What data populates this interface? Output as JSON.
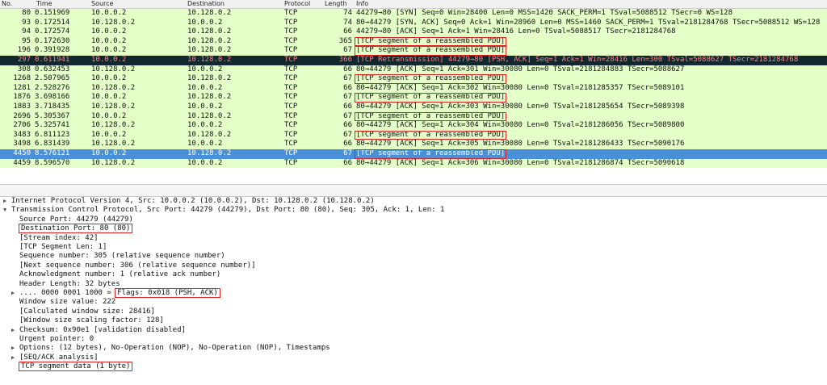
{
  "columns": {
    "no": "No.",
    "time": "Time",
    "source": "Source",
    "destination": "Destination",
    "protocol": "Protocol",
    "length": "Length",
    "info": "Info"
  },
  "packets": [
    {
      "no": "80",
      "time": "0.151969",
      "src": "10.0.0.2",
      "dst": "10.128.0.2",
      "proto": "TCP",
      "len": "74",
      "info": "44279→80 [SYN] Seq=0 Win=28400 Len=0 MSS=1420 SACK_PERM=1 TSval=5088512 TSecr=0 WS=128",
      "style": "green",
      "hl": ""
    },
    {
      "no": "93",
      "time": "0.172514",
      "src": "10.128.0.2",
      "dst": "10.0.0.2",
      "proto": "TCP",
      "len": "74",
      "info": "80→44279 [SYN, ACK] Seq=0 Ack=1 Win=28960 Len=0 MSS=1460 SACK_PERM=1 TSval=2181284768 TSecr=5088512 WS=128",
      "style": "green",
      "hl": ""
    },
    {
      "no": "94",
      "time": "0.172574",
      "src": "10.0.0.2",
      "dst": "10.128.0.2",
      "proto": "TCP",
      "len": "66",
      "info": "44279→80 [ACK] Seq=1 Ack=1 Win=28416 Len=0 TSval=5088517 TSecr=2181284768",
      "style": "green",
      "hl": ""
    },
    {
      "no": "95",
      "time": "0.172630",
      "src": "10.0.0.2",
      "dst": "10.128.0.2",
      "proto": "TCP",
      "len": "365",
      "info": "[TCP segment of a reassembled PDU]",
      "style": "green",
      "hl": "box"
    },
    {
      "no": "196",
      "time": "0.391928",
      "src": "10.0.0.2",
      "dst": "10.128.0.2",
      "proto": "TCP",
      "len": "67",
      "info": "[TCP segment of a reassembled PDU]",
      "style": "green",
      "hl": "box"
    },
    {
      "no": "297",
      "time": "0.611941",
      "src": "10.0.0.2",
      "dst": "10.128.0.2",
      "proto": "TCP",
      "len": "366",
      "info": "[TCP Retransmission] 44279→80 [PSH, ACK] Seq=1 Ack=1 Win=28416 Len=300 TSval=5088627 TSecr=2181284768",
      "style": "dark",
      "hl": ""
    },
    {
      "no": "308",
      "time": "0.632453",
      "src": "10.128.0.2",
      "dst": "10.0.0.2",
      "proto": "TCP",
      "len": "66",
      "info": "80→44279 [ACK] Seq=1 Ack=301 Win=30080 Len=0 TSval=2181284883 TSecr=5088627",
      "style": "green",
      "hl": ""
    },
    {
      "no": "1268",
      "time": "2.507965",
      "src": "10.0.0.2",
      "dst": "10.128.0.2",
      "proto": "TCP",
      "len": "67",
      "info": "[TCP segment of a reassembled PDU]",
      "style": "green",
      "hl": "box"
    },
    {
      "no": "1281",
      "time": "2.528276",
      "src": "10.128.0.2",
      "dst": "10.0.0.2",
      "proto": "TCP",
      "len": "66",
      "info": "80→44279 [ACK] Seq=1 Ack=302 Win=30080 Len=0 TSval=2181285357 TSecr=5089101",
      "style": "green",
      "hl": ""
    },
    {
      "no": "1876",
      "time": "3.698166",
      "src": "10.0.0.2",
      "dst": "10.128.0.2",
      "proto": "TCP",
      "len": "67",
      "info": "[TCP segment of a reassembled PDU]",
      "style": "green",
      "hl": "box"
    },
    {
      "no": "1883",
      "time": "3.718435",
      "src": "10.128.0.2",
      "dst": "10.0.0.2",
      "proto": "TCP",
      "len": "66",
      "info": "80→44279 [ACK] Seq=1 Ack=303 Win=30080 Len=0 TSval=2181285654 TSecr=5089398",
      "style": "green",
      "hl": ""
    },
    {
      "no": "2696",
      "time": "5.305367",
      "src": "10.0.0.2",
      "dst": "10.128.0.2",
      "proto": "TCP",
      "len": "67",
      "info": "[TCP segment of a reassembled PDU]",
      "style": "green",
      "hl": "box"
    },
    {
      "no": "2706",
      "time": "5.325741",
      "src": "10.128.0.2",
      "dst": "10.0.0.2",
      "proto": "TCP",
      "len": "66",
      "info": "80→44279 [ACK] Seq=1 Ack=304 Win=30080 Len=0 TSval=2181286056 TSecr=5089800",
      "style": "green",
      "hl": ""
    },
    {
      "no": "3483",
      "time": "6.811123",
      "src": "10.0.0.2",
      "dst": "10.128.0.2",
      "proto": "TCP",
      "len": "67",
      "info": "[TCP segment of a reassembled PDU]",
      "style": "green",
      "hl": "box"
    },
    {
      "no": "3498",
      "time": "6.831439",
      "src": "10.128.0.2",
      "dst": "10.0.0.2",
      "proto": "TCP",
      "len": "66",
      "info": "80→44279 [ACK] Seq=1 Ack=305 Win=30080 Len=0 TSval=2181286433 TSecr=5090176",
      "style": "green",
      "hl": ""
    },
    {
      "no": "4450",
      "time": "8.576121",
      "src": "10.0.0.2",
      "dst": "10.128.0.2",
      "proto": "TCP",
      "len": "67",
      "info": "[TCP segment of a reassembled PDU]",
      "style": "selected",
      "hl": "box"
    },
    {
      "no": "4459",
      "time": "8.596570",
      "src": "10.128.0.2",
      "dst": "10.0.0.2",
      "proto": "TCP",
      "len": "66",
      "info": "80→44279 [ACK] Seq=1 Ack=306 Win=30080 Len=0 TSval=2181286874 TSecr=5090618",
      "style": "green",
      "hl": ""
    }
  ],
  "details": [
    {
      "indent": 0,
      "arrow": "▶",
      "text": "Internet Protocol Version 4, Src: 10.0.0.2 (10.0.0.2), Dst: 10.128.0.2 (10.128.0.2)",
      "box": false
    },
    {
      "indent": 0,
      "arrow": "▼",
      "text": "Transmission Control Protocol, Src Port: 44279 (44279), Dst Port: 80 (80), Seq: 305, Ack: 1, Len: 1",
      "box": false
    },
    {
      "indent": 1,
      "arrow": "",
      "text": "Source Port: 44279 (44279)",
      "box": false
    },
    {
      "indent": 1,
      "arrow": "",
      "text": "Destination Port: 80 (80)",
      "box": true
    },
    {
      "indent": 1,
      "arrow": "",
      "text": "[Stream index: 42]",
      "box": false
    },
    {
      "indent": 1,
      "arrow": "",
      "text": "[TCP Segment Len: 1]",
      "box": false
    },
    {
      "indent": 1,
      "arrow": "",
      "text": "Sequence number: 305    (relative sequence number)",
      "box": false
    },
    {
      "indent": 1,
      "arrow": "",
      "text": "[Next sequence number: 306    (relative sequence number)]",
      "box": false
    },
    {
      "indent": 1,
      "arrow": "",
      "text": "Acknowledgment number: 1    (relative ack number)",
      "box": false
    },
    {
      "indent": 1,
      "arrow": "",
      "text": "Header Length: 32 bytes",
      "box": false
    },
    {
      "indent": 1,
      "arrow": "▶",
      "text": ".... 0000 0001 1000 = ",
      "text2": "Flags: 0x018 (PSH, ACK)",
      "box": "partial"
    },
    {
      "indent": 1,
      "arrow": "",
      "text": "Window size value: 222",
      "box": false
    },
    {
      "indent": 1,
      "arrow": "",
      "text": "[Calculated window size: 28416]",
      "box": false
    },
    {
      "indent": 1,
      "arrow": "",
      "text": "[Window size scaling factor: 128]",
      "box": false
    },
    {
      "indent": 1,
      "arrow": "▶",
      "text": "Checksum: 0x90e1 [validation disabled]",
      "box": false
    },
    {
      "indent": 1,
      "arrow": "",
      "text": "Urgent pointer: 0",
      "box": false
    },
    {
      "indent": 1,
      "arrow": "▶",
      "text": "Options: (12 bytes), No-Operation (NOP), No-Operation (NOP), Timestamps",
      "box": false
    },
    {
      "indent": 1,
      "arrow": "▶",
      "text": "[SEQ/ACK analysis]",
      "box": false
    },
    {
      "indent": 1,
      "arrow": "",
      "text": "TCP segment data (1 byte)",
      "box": true
    }
  ],
  "colors": {
    "green": "#e4ffc7",
    "dark": "#12272e",
    "selected": "#4a90d9",
    "highlight_box": "#e02020"
  }
}
